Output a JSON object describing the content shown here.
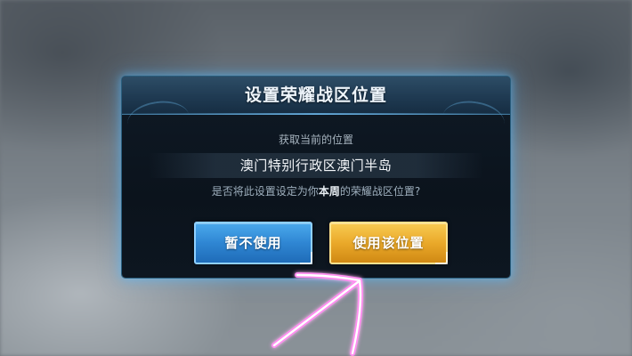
{
  "dialog": {
    "title": "设置荣耀战区位置",
    "current_location_label": "获取当前的位置",
    "location_value": "澳门特别行政区澳门半岛",
    "question_prefix": "是否将此设置设定为你",
    "question_highlight": "本周",
    "question_suffix": "的荣耀战区位置?",
    "buttons": {
      "decline_label": "暂不使用",
      "accept_label": "使用该位置"
    }
  },
  "colors": {
    "decline_button": "#2f86d3",
    "accept_button": "#eaa92a",
    "frame_glow": "#5abeff",
    "annotation_stroke": "#ff3fd8"
  },
  "annotation": {
    "icon": "hand-drawn-arrow-icon"
  }
}
